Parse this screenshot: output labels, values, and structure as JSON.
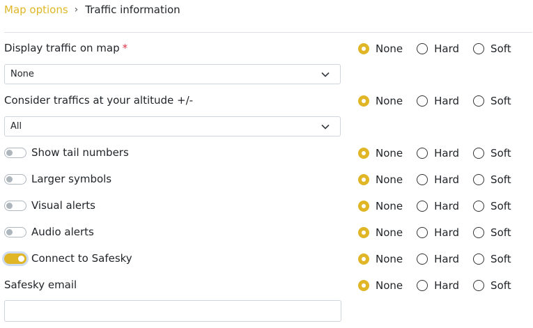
{
  "breadcrumb": {
    "parent": "Map options",
    "separator": "›",
    "current": "Traffic information"
  },
  "colors": {
    "accent": "#e0b627",
    "required": "#dc3545"
  },
  "radio_options": [
    "None",
    "Hard",
    "Soft"
  ],
  "fields": {
    "display_traffic": {
      "label": "Display traffic on map",
      "required_mark": "*",
      "select_value": "None"
    },
    "altitude": {
      "label": "Consider traffics at your altitude +/-",
      "select_value": "All"
    },
    "tail_numbers": {
      "label": "Show tail numbers",
      "enabled": false
    },
    "larger_symbols": {
      "label": "Larger symbols",
      "enabled": false
    },
    "visual_alerts": {
      "label": "Visual alerts",
      "enabled": false
    },
    "audio_alerts": {
      "label": "Audio alerts",
      "enabled": false
    },
    "safesky": {
      "label": "Connect to Safesky",
      "enabled": true
    },
    "safesky_email": {
      "label": "Safesky email",
      "value": ""
    }
  },
  "radio_selected": "None"
}
